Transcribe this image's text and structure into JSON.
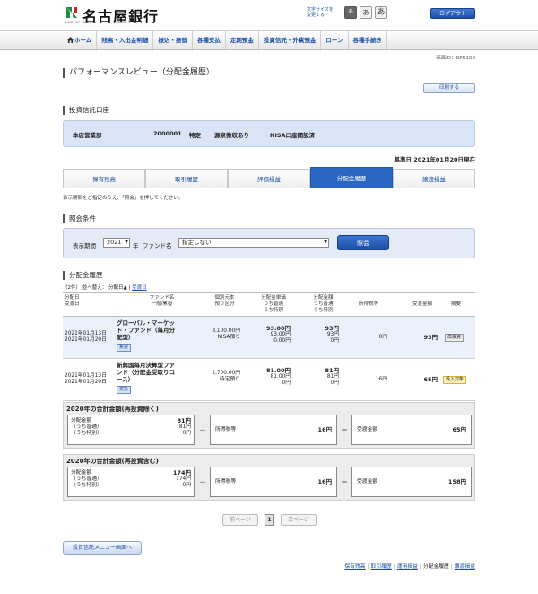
{
  "header": {
    "bank_name": "名古屋銀行",
    "bank_sub": "BANK OF NAGOYA",
    "font_size_label_1": "文字サイズを",
    "font_size_label_2": "変更する",
    "font_sizes": [
      "あ",
      "あ",
      "あ"
    ],
    "logout": "ログアウト"
  },
  "nav": {
    "items": [
      "ホーム",
      "残高・入出金明細",
      "振込・振替",
      "各種支払",
      "定期預金",
      "投資信託・外貨預金",
      "ローン",
      "各種手続き"
    ]
  },
  "screen_id": "画面ID：BPR108",
  "page_title": "パフォーマンスレビュー（分配金履歴）",
  "print_button": "印刷する",
  "account_section": {
    "heading": "投資信託口座",
    "branch": "本店営業部",
    "account_no": "2000001",
    "type": "特定",
    "withholding": "源泉徴収あり",
    "nisa": "NISA口座開設済"
  },
  "base_date": "基準日 2021年01月20日現在",
  "tabs": [
    {
      "label": "保有残高",
      "active": false
    },
    {
      "label": "取引履歴",
      "active": false
    },
    {
      "label": "評価損益",
      "active": false
    },
    {
      "label": "分配金履歴",
      "active": true
    },
    {
      "label": "譲渡損益",
      "active": false
    }
  ],
  "note": "表示期間をご指定のうえ、「照会」を押してください。",
  "condition": {
    "heading": "照会条件",
    "period_label": "表示期間",
    "year_value": "2021",
    "year_unit": "年",
    "fund_label": "ファンド名",
    "fund_value": "指定しない",
    "search_button": "照会"
  },
  "history": {
    "heading": "分配金履歴",
    "count": "（2件）",
    "sort_label": "並べ替え：",
    "sort_active": "分配日▲",
    "sort_sep": "|",
    "sort_other": "受渡日",
    "headers": {
      "date": [
        "分配日",
        "受渡日"
      ],
      "fund": [
        "ファンド名",
        "一般/累投"
      ],
      "principal": [
        "個別元本",
        "預り区分"
      ],
      "unit_price": [
        "分配金単価",
        "うち普通",
        "うち特別"
      ],
      "amount": [
        "分配金額",
        "うち普通",
        "うち特別"
      ],
      "tax": "所得税等",
      "received": "受渡金額",
      "summary": "摘要"
    },
    "rows": [
      {
        "dist_date": "2021年01月13日",
        "deliv_date": "2021年01月20日",
        "fund_name": "グローバル・マーケット・ファンド（毎月分配型）",
        "fund_lines": [
          "グローバル・マーケッ",
          "ト・ファンド（毎月分",
          "配型）"
        ],
        "kind": "累投",
        "principal": "3,100.00円",
        "deposit": "NISA預り",
        "unit_price": "93.00円",
        "unit_normal": "93.00円",
        "unit_special": "0.00円",
        "amount": "93円",
        "amount_normal": "93円",
        "amount_special": "0円",
        "tax": "0円",
        "received": "93円",
        "summary": "再投資"
      },
      {
        "dist_date": "2021年01月13日",
        "deliv_date": "2021年01月20日",
        "fund_name": "新興国毎月決算型ファンド（分配金受取りコース）",
        "fund_lines": [
          "新興国毎月決算型ファ",
          "ンド（分配金受取りコ",
          "ース）"
        ],
        "kind": "累投",
        "principal": "2,700.00円",
        "deposit": "特定預り",
        "unit_price": "81.00円",
        "unit_normal": "81.00円",
        "unit_special": "0円",
        "amount": "81円",
        "amount_normal": "81円",
        "amount_special": "0円",
        "tax": "16円",
        "received": "65円",
        "summary": "受入対象"
      }
    ]
  },
  "totals": [
    {
      "title": "2020年の合計金額(再投資除く)",
      "dist_label": "分配金額",
      "dist_value": "81円",
      "normal_label": "（うち普通）",
      "normal_value": "81円",
      "special_label": "（うち特別）",
      "special_value": "0円",
      "minus": "－",
      "tax_label": "所得税等",
      "tax_value": "16円",
      "equals": "＝",
      "recv_label": "受渡金額",
      "recv_value": "65円"
    },
    {
      "title": "2020年の合計金額(再投資含む)",
      "dist_label": "分配金額",
      "dist_value": "174円",
      "normal_label": "（うち普通）",
      "normal_value": "174円",
      "special_label": "（うち特別）",
      "special_value": "0円",
      "minus": "－",
      "tax_label": "所得税等",
      "tax_value": "16円",
      "equals": "＝",
      "recv_label": "受渡金額",
      "recv_value": "158円"
    }
  ],
  "pager": {
    "prev": "前ページ",
    "current": "1",
    "next": "次ページ"
  },
  "back_button": "投資信託メニュー画面へ",
  "footer_links": [
    "保有残高",
    "取引履歴",
    "運用損益",
    "分配金履歴",
    "譲渡損益"
  ],
  "footer_sep": "|",
  "colors": {
    "accent": "#2a67c2",
    "link": "#1a4ea8",
    "logo_green": "#1f8a3a",
    "row_highlight": "#eaf1fb",
    "account_bg": "#d9e4f6"
  }
}
